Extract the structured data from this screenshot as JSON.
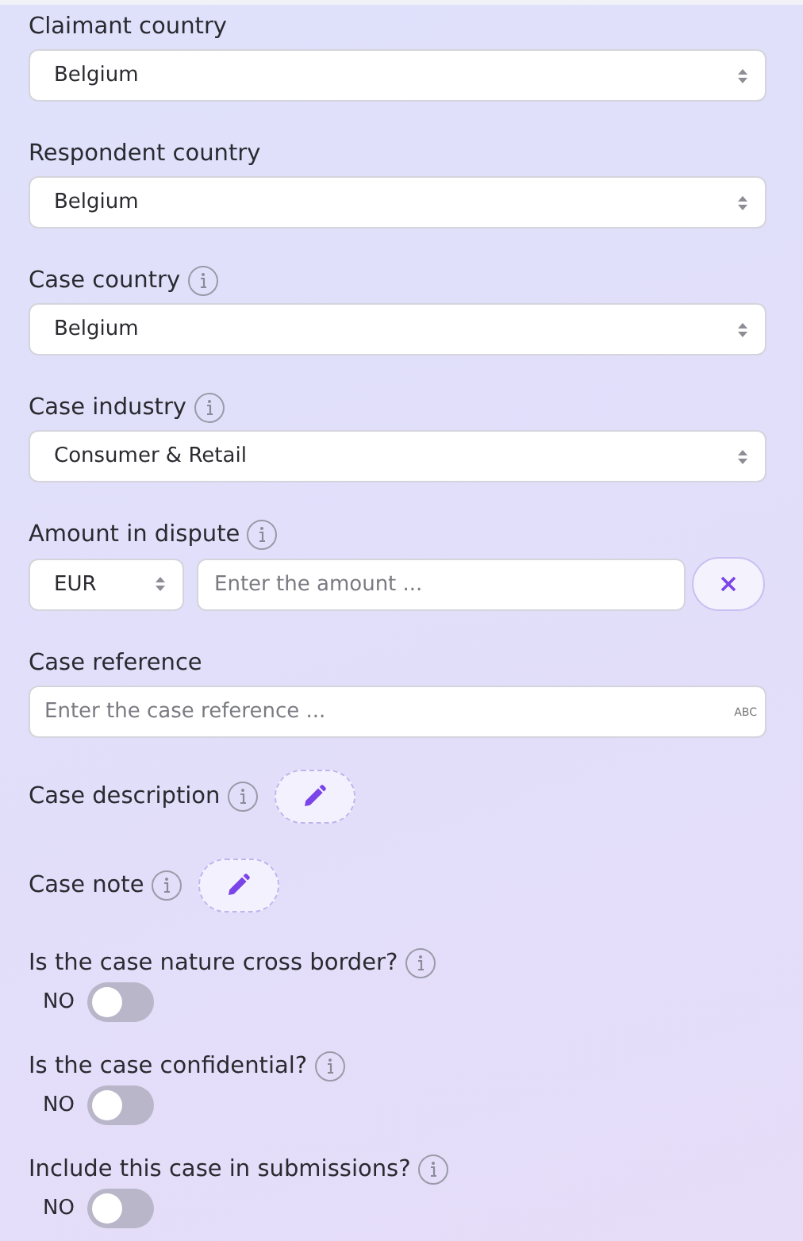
{
  "fields": [
    {
      "kind": "select",
      "label": "Claimant country",
      "info": false,
      "value": "Belgium"
    },
    {
      "kind": "select",
      "label": "Respondent country",
      "info": false,
      "value": "Belgium"
    },
    {
      "kind": "select",
      "label": "Case country",
      "info": true,
      "value": "Belgium"
    },
    {
      "kind": "select",
      "label": "Case industry",
      "info": true,
      "value": "Consumer & Retail"
    },
    {
      "kind": "amount",
      "label": "Amount in dispute",
      "info": true,
      "currency": "EUR",
      "placeholder": "Enter the amount ..."
    },
    {
      "kind": "text",
      "label": "Case reference",
      "info": false,
      "placeholder": "Enter the case reference ...",
      "hint": "ABC"
    },
    {
      "kind": "edit",
      "label": "Case description",
      "info": true
    },
    {
      "kind": "edit",
      "label": "Case note",
      "info": true
    },
    {
      "kind": "toggle",
      "label": "Is the case nature cross border?",
      "info": true,
      "state_text": "NO",
      "on": false
    },
    {
      "kind": "toggle",
      "label": "Is the case confidential?",
      "info": true,
      "state_text": "NO",
      "on": false
    },
    {
      "kind": "toggle",
      "label": "Include this case in submissions?",
      "info": true,
      "state_text": "NO",
      "on": false
    }
  ]
}
